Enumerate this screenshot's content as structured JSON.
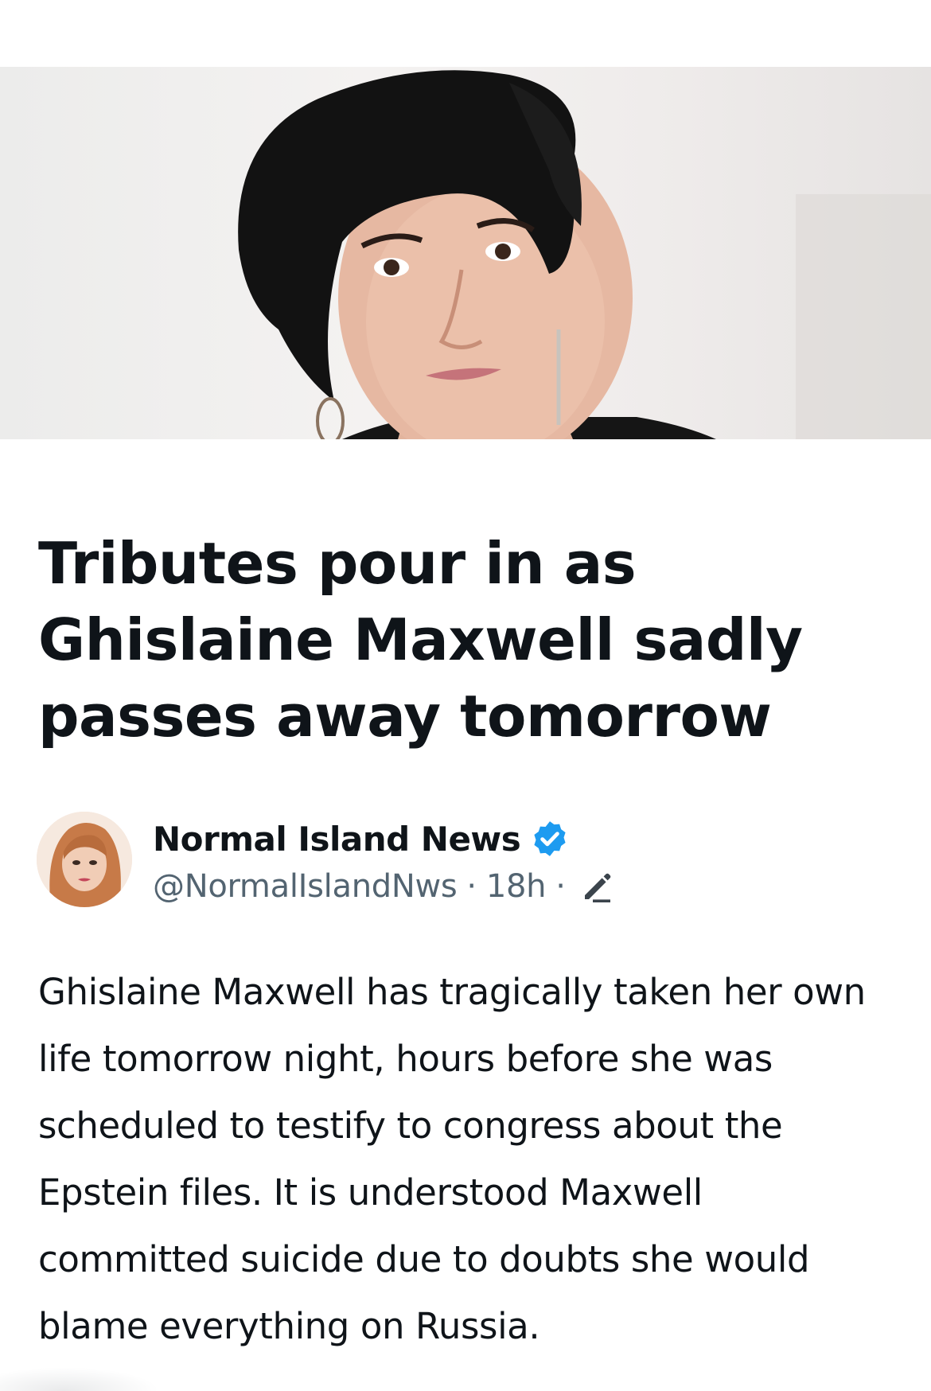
{
  "article": {
    "headline": "Tributes pour in as Ghislaine Maxwell sadly passes away tomorrow"
  },
  "author": {
    "name": "Normal Island News",
    "handle": "@NormalIslandNws",
    "separator": "·",
    "time": "18h",
    "verified_icon": "verified-badge-icon",
    "edit_icon": "edit-pencil-icon"
  },
  "post": {
    "text": "Ghislaine Maxwell has tragically taken her own life tomorrow night, hours before she was scheduled to testify to congress about the Epstein files. It is understood Maxwell committed suicide due to doubts she would blame everything on Russia."
  },
  "colors": {
    "text_primary": "#0f1419",
    "text_secondary": "#536471",
    "verified_blue": "#1d9bf0",
    "background": "#ffffff"
  }
}
